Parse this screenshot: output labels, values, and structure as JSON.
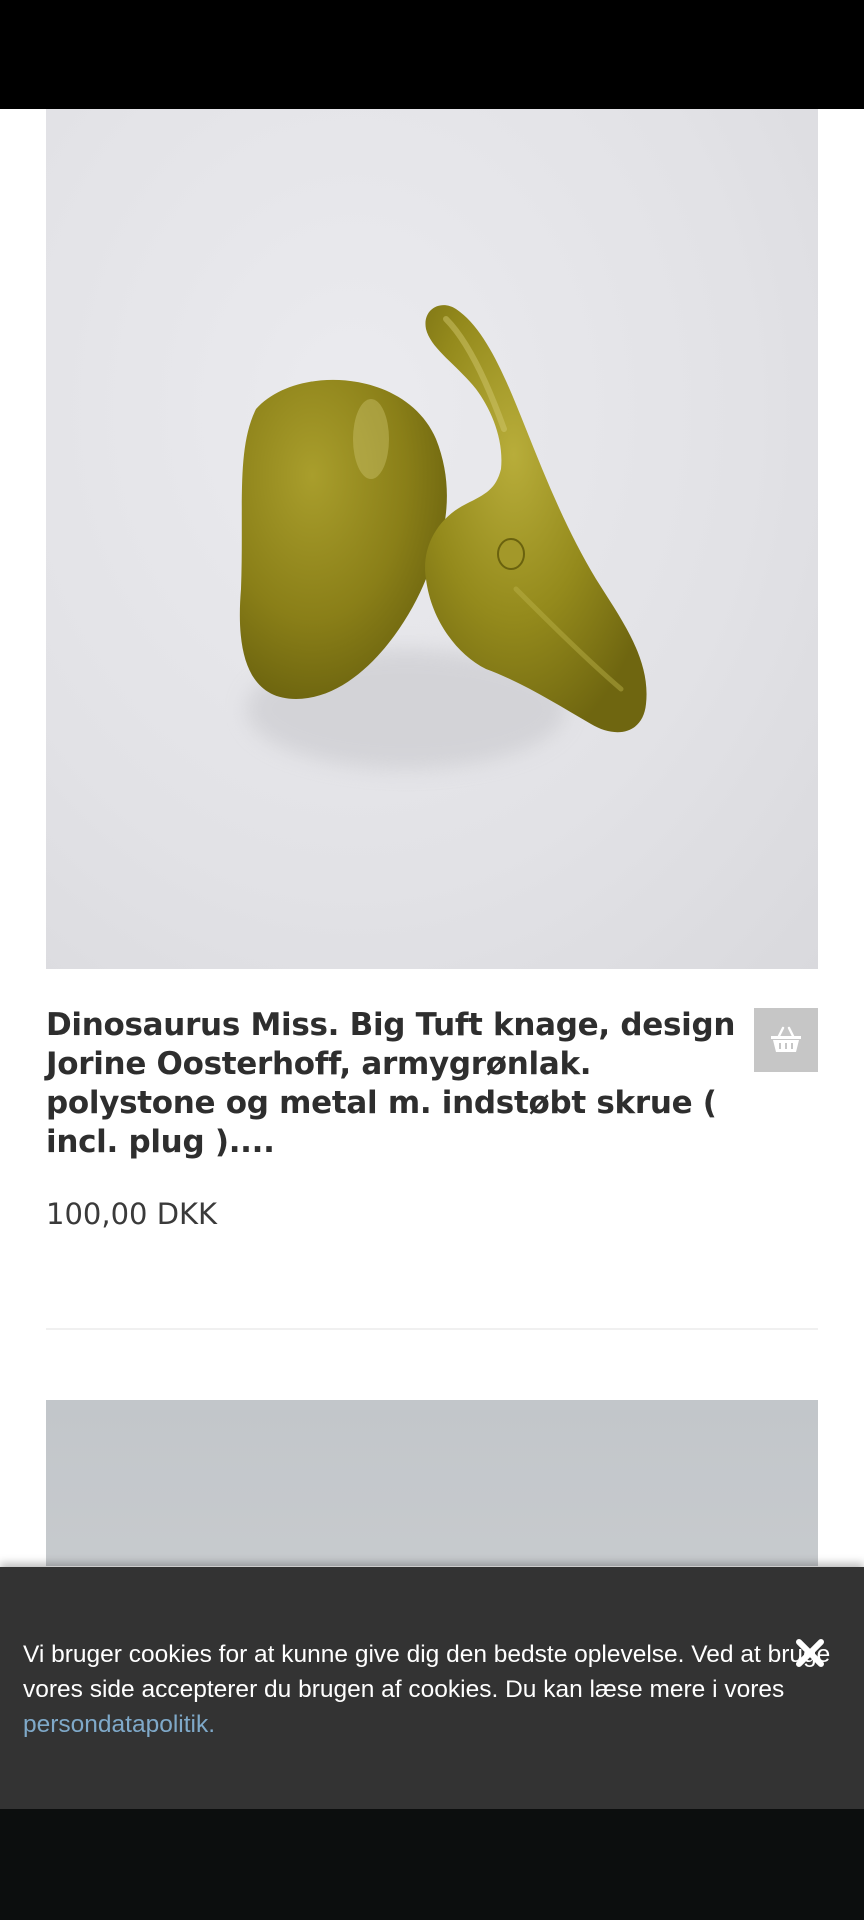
{
  "product": {
    "title": "Dinosaurus Miss. Big Tuft knage, design Jorine Oosterhoff, armygrønlak. polystone og metal m. indstøbt skrue ( incl. plug )....",
    "price": "100,00 DKK",
    "image_icon": "dinosaur-hook-photo",
    "basket_icon": "basket-icon"
  },
  "cookie_banner": {
    "text": "Vi bruger cookies for at kunne give dig den bedste oplevelse. Ved at bruge vores side accepterer du brugen af cookies. Du kan læse mere i vores ",
    "link_label": "persondatapolitik.",
    "close_icon": "close-icon"
  },
  "colors": {
    "banner_bg": "#333333",
    "link": "#7fa9c9",
    "basket_bg": "#c6c6c6",
    "hook_color": "#8f8417"
  }
}
